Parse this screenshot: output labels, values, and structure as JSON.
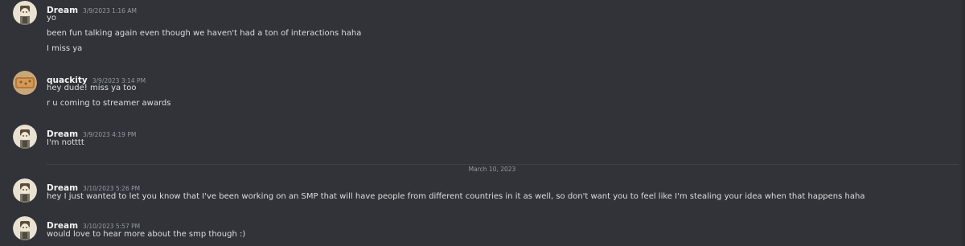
{
  "messages": [
    {
      "author": "Dream",
      "timestamp": "3/9/2023 1:16 AM",
      "lines": [
        "yo",
        "been fun talking again even though we haven't had a ton of interactions haha",
        "I miss ya"
      ]
    },
    {
      "author": "quackity",
      "timestamp": "3/9/2023 3:14 PM",
      "lines": [
        "hey dude! miss ya too",
        "r u coming to streamer awards"
      ]
    },
    {
      "author": "Dream",
      "timestamp": "3/9/2023 4:19 PM",
      "lines": [
        "I'm notttt"
      ]
    },
    {
      "author": "Dream",
      "timestamp": "3/10/2023 5:26 PM",
      "lines": [
        "hey I just wanted to let you know that I've been working on an SMP that will have people from different countries in it as well, so don't want you to feel like I'm stealing your idea when that happens haha"
      ]
    },
    {
      "author": "Dream",
      "timestamp": "3/10/2023 5:57 PM",
      "lines": [
        "would love to hear more about the smp though :)"
      ]
    }
  ],
  "date_divider": "March 10, 2023",
  "icons": {
    "dream_avatar": "dream-avatar-icon",
    "quackity_avatar": "quackity-avatar-icon"
  },
  "colors": {
    "background": "#313338",
    "username": "#f2f3f5",
    "text": "#dbdee1",
    "muted": "#949ba4",
    "divider": "#3f4147"
  }
}
